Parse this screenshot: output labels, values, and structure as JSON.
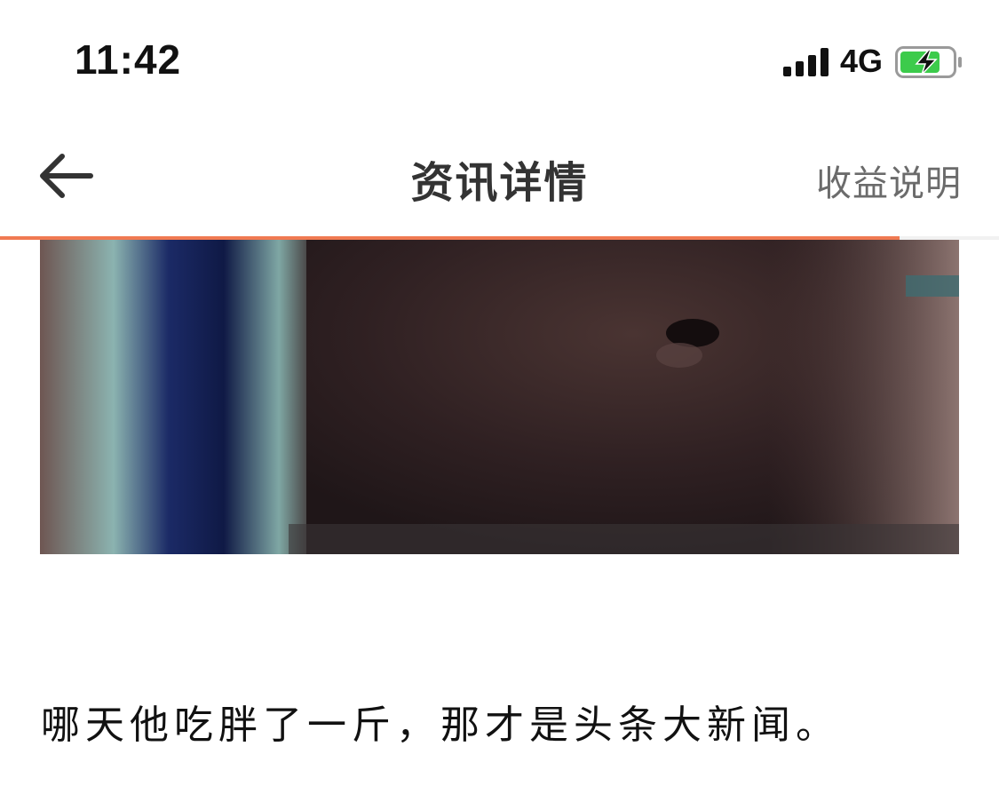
{
  "status_bar": {
    "time": "11:42",
    "network": "4G",
    "battery_level": 0.75,
    "battery_charging": true,
    "battery_color": "#3ccb4b"
  },
  "nav": {
    "title": "资讯详情",
    "right_action": "收益说明",
    "back_icon": "arrow-left-icon",
    "reading_progress": 0.9
  },
  "article": {
    "media_type": "animated-image",
    "paragraph": "哪天他吃胖了一斤，那才是头条大新闻。"
  },
  "colors": {
    "accent": "#f07a52",
    "title": "#333333",
    "secondary": "#6b6b6b"
  }
}
